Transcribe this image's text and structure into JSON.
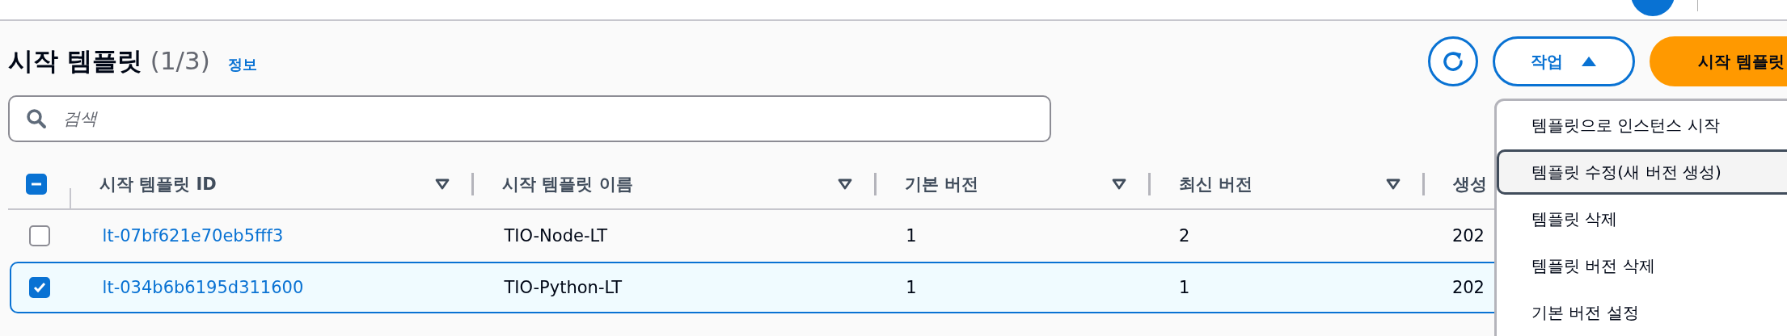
{
  "header": {
    "title": "시작 템플릿",
    "count": "(1/3)",
    "info_link": "정보"
  },
  "toolbar": {
    "actions_button": {
      "label": "작업",
      "expanded": true
    },
    "create_button": {
      "label": "시작 템플릿"
    }
  },
  "search": {
    "placeholder": "검색"
  },
  "table": {
    "select_all": {
      "indeterminate": true
    },
    "columns": [
      {
        "label": "시작 템플릿 ID",
        "sortable": true
      },
      {
        "label": "시작 템플릿 이름",
        "sortable": true
      },
      {
        "label": "기본 버전",
        "sortable": true
      },
      {
        "label": "최신 버전",
        "sortable": true
      },
      {
        "label": "생성",
        "sortable": false
      }
    ],
    "rows": [
      {
        "selected": false,
        "cells": [
          "lt-07bf621e70eb5fff3",
          "TIO-Node-LT",
          "1",
          "2",
          "202"
        ]
      },
      {
        "selected": true,
        "cells": [
          "lt-034b6b6195d311600",
          "TIO-Python-LT",
          "1",
          "1",
          "202"
        ]
      }
    ]
  },
  "menu": {
    "items": [
      {
        "label": "템플릿으로 인스턴스 시작",
        "selected": false
      },
      {
        "label": "템플릿 수정(새 버전 생성)",
        "selected": true
      },
      {
        "label": "템플릿 삭제",
        "selected": false
      },
      {
        "label": "템플릿 버전 삭제",
        "selected": false
      },
      {
        "label": "기본 버전 설정",
        "selected": false
      }
    ]
  }
}
